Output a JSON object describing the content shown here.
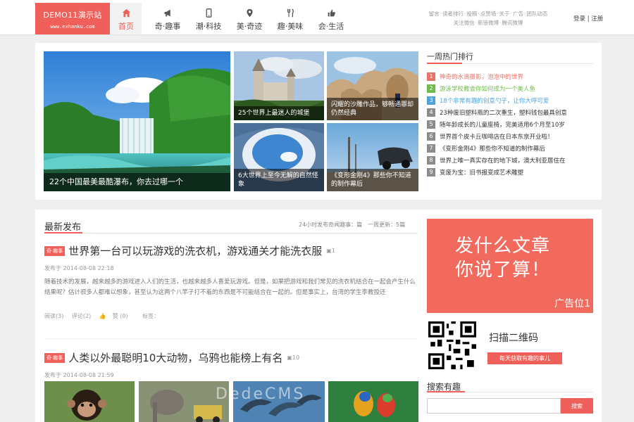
{
  "site": {
    "logo_title": "DEMO11演示站",
    "logo_url": "www.exhanku.com"
  },
  "nav": [
    {
      "label": "首页",
      "icon": "home-icon",
      "active": true
    },
    {
      "label": "奇·趣事",
      "icon": "megaphone-icon"
    },
    {
      "label": "潮·科技",
      "icon": "phone-icon"
    },
    {
      "label": "美·奇迹",
      "icon": "location-pin-icon"
    },
    {
      "label": "趣·美味",
      "icon": "fork-knife-icon"
    },
    {
      "label": "会·生活",
      "icon": "thumbs-up-icon"
    }
  ],
  "utility_links": {
    "row1": [
      "留言",
      "读者排行",
      "投稿",
      "点赞墙",
      "关于",
      "广告",
      "团队动态"
    ],
    "row2": [
      "关注微信",
      "新浪微博",
      "腾讯微博"
    ]
  },
  "auth": {
    "login": "登录",
    "register": "注册"
  },
  "featured": {
    "big": {
      "caption": "22个中国最美最酷瀑布，你去过哪一个"
    },
    "tiles": [
      {
        "caption": "25个世界上最迷人的城堡"
      },
      {
        "caption": "闪耀的沙雕作品，够畅通罪却仍然经典"
      },
      {
        "caption": "6大世界上至今无解的自然怪象"
      },
      {
        "caption": "《变形金刚4》那些你不知道的制作幕后"
      }
    ]
  },
  "hot": {
    "title": "一周热门排行",
    "items": [
      {
        "rank": "1",
        "text": "神奇的水滴摄影，泡泡中的世界"
      },
      {
        "rank": "2",
        "text": "游泳学校教会你如何成为一个美人鱼"
      },
      {
        "rank": "3",
        "text": "18个非常有趣的创意勺子，让你大呼可爱"
      },
      {
        "rank": "4",
        "text": "23种废旧塑料瓶的二次重生，塑料钱包最具创意"
      },
      {
        "rank": "5",
        "text": "随年龄成长的儿童座椅，完美适用6个月至10岁"
      },
      {
        "rank": "6",
        "text": "世界首个皮卡丘咖啡店在日本东京开业啦！"
      },
      {
        "rank": "7",
        "text": "《变形金刚4》那些你不知道的制作幕后"
      },
      {
        "rank": "8",
        "text": "世界上唯一真实存在的地下城，澳大利亚居住在"
      },
      {
        "rank": "9",
        "text": "变废为宝：旧书报变成艺术雕塑"
      }
    ]
  },
  "latest": {
    "title": "最新发布",
    "stats": "24小时发布奇闻趣事：篇　一周更新：5篇",
    "articles": [
      {
        "tag": "奇·趣事",
        "title": "世界第一台可以玩游戏的洗衣机，游戏通关才能洗衣服",
        "img_count": "1",
        "date": "发布于 2014-08-08 22:18",
        "summary": "随着技术的发展，越来越多的游戏进入人们的生活，也越来越多人喜爱玩游戏。但是，如果把游戏和我们常见的洗衣机结合在一起会产生什么结果呢？估计很多人都难以想象，甚至认为这两个八竿子打不着的东西是不可能结合在一起的。但是事实上，台湾的学生李教授还",
        "reads": "阅读(3)",
        "comments": "评论(2)",
        "likes": "赞 (0)",
        "tags_label": "标签："
      },
      {
        "tag": "奇·趣事",
        "title": "人类以外最聪明10大动物，乌鸦也能榜上有名",
        "img_count": "10",
        "date": "发布于 2014-08-08 21:59"
      }
    ]
  },
  "ad": {
    "line1": "发什么文章",
    "line2": "你说了算！",
    "slot": "广告位1"
  },
  "qr": {
    "label": "扫描二维码",
    "button": "每天获取有趣的事儿"
  },
  "search": {
    "title": "搜索有趣",
    "placeholder": "",
    "button": "搜索"
  },
  "watermark": "DedeCMS"
}
